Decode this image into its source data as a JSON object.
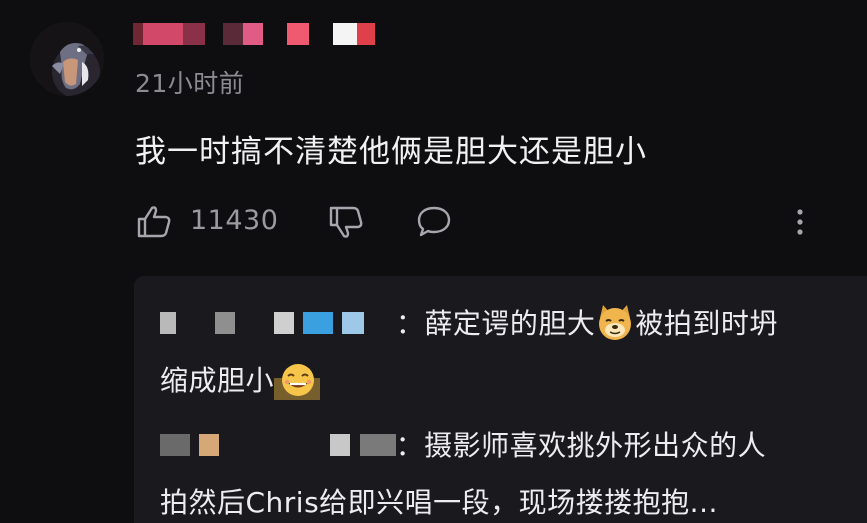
{
  "comment": {
    "avatar": "bird-avatar",
    "username_blur_colors": [
      "#c23a50",
      "#d24868",
      "#8a3048",
      "#e05c84",
      "#f05a70",
      "#f4f4f4",
      "#e0404a"
    ],
    "timestamp": "21小时前",
    "text": "我一时搞不清楚他俩是胆大还是胆小",
    "actions": {
      "like_icon": "thumbs-up-icon",
      "like_count": "11430",
      "dislike_icon": "thumbs-down-icon",
      "reply_icon": "speech-bubble-icon",
      "more_icon": "vertical-dots-icon"
    }
  },
  "replies": [
    {
      "name_blur_colors": [
        "#b9b9b9",
        "#8f8f8f",
        "#3aa0e0",
        "#9ec8e8",
        "#cfcfcf"
      ],
      "line1_text": "薛定谔的胆大",
      "emoji1": "doge-emoji",
      "line1_rest": "被拍到时坍",
      "line2_text": "缩成胆小",
      "emoji2": "grin-emoji"
    },
    {
      "name_blur_colors": [
        "#d6a878",
        "#c8c8c8",
        "#7a7a7a"
      ],
      "line1_text": "摄影师喜欢挑外形出众的人",
      "line2_text": "拍然后Chris给即兴唱一段，现场搂搂抱抱..."
    }
  ]
}
